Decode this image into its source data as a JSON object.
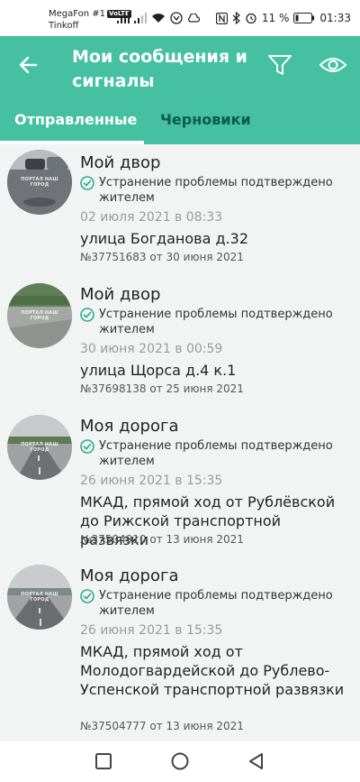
{
  "status_bar": {
    "carrier1": "MegaFon #1",
    "volte": "VoLTE",
    "carrier2": "Tinkoff",
    "battery": "11 %",
    "time": "01:33"
  },
  "header": {
    "title": "Мои сообщения и сигналы",
    "tabs": [
      {
        "label": "Отправленные",
        "active": true
      },
      {
        "label": "Черновики",
        "active": false
      }
    ]
  },
  "messages": [
    {
      "category": "Мой двор",
      "status": "Устранение проблемы подтверждено жителем",
      "date": "02 июля 2021 в 08:33",
      "address": "улица Богданова д.32",
      "number": "№37751683 от 30 июня 2021",
      "thumb_watermark": "ПОРТАЛ НАШ ГОРОД"
    },
    {
      "category": "Мой двор",
      "status": "Устранение проблемы подтверждено жителем",
      "date": "30 июня 2021 в 00:59",
      "address": "улица Щорса д.4 к.1",
      "number": "№37698138 от 25 июня 2021",
      "thumb_watermark": "ПОРТАЛ НАШ ГОРОД"
    },
    {
      "category": "Моя дорога",
      "status": "Устранение проблемы подтверждено жителем",
      "date": "26 июня 2021 в 15:35",
      "address": "МКАД, прямой ход от Рублёвской до Рижской транспортной развязки",
      "number": "№37504910 от 13 июня 2021",
      "thumb_watermark": "ПОРТАЛ НАШ ГОРОД"
    },
    {
      "category": "Моя дорога",
      "status": "Устранение проблемы подтверждено жителем",
      "date": "26 июня 2021 в 15:35",
      "address": "МКАД, прямой ход от Молодогвардейской до Рублево-Успенской транспортной развязки",
      "number": "№37504777 от 13 июня 2021",
      "thumb_watermark": "ПОРТАЛ НАШ ГОРОД"
    }
  ],
  "colors": {
    "accent": "#45c0a1",
    "check": "#2fae8a",
    "inactive_tab": "#0f5a48"
  },
  "icons": {
    "back": "arrow-left-icon",
    "filter": "funnel-icon",
    "view": "eye-icon",
    "status": "check-circle-icon",
    "nav": [
      "square-icon",
      "circle-icon",
      "triangle-back-icon"
    ]
  }
}
